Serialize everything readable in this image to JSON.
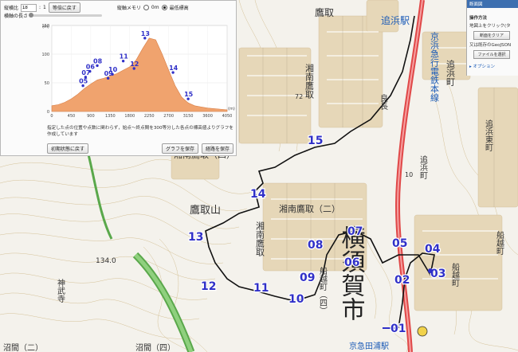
{
  "panel": {
    "ratio_label": "縦横比",
    "ratio_value": "18",
    "ratio_unit": "1",
    "equal_button": "等倍に戻す",
    "axis_label": "縦軸メモリ",
    "radio_zero": "0m",
    "radio_min": "最低標高",
    "length_label": "横軸の長さ",
    "note": "指定した点の位置や点数に関わらず，始点～終点間を300等分した各点の標高値よりグラフを作成しています",
    "reset_button": "初期状態に戻す",
    "save_graph_button": "グラフを保存",
    "save_route_button": "経路を保存"
  },
  "right_panel": {
    "header": "断面図",
    "title": "操作方法",
    "line1": "地図上をクリック(タ",
    "clear_button": "断面をクリア",
    "line2": "又は既存のGeoJSON",
    "file_button": "ファイルを選択",
    "options": "▸ オプション"
  },
  "map_labels": {
    "takatori_top": "鷹取",
    "oppama_station": "追浜駅",
    "keikyu_line": "京浜急行電鉄本線",
    "oppama_cho": "追浜町",
    "oppama_higashi": "追浜東町",
    "shonan_takatori": "湘南鷹取",
    "shonan_takatori_4": "湘南鷹取（四）",
    "takatoriyama": "鷹取山",
    "shonan_takatori_2": "湘南鷹取（二）",
    "shonan_takatori_v": "湘南鷹取",
    "yokosuka": "横須賀市",
    "funakoshi": "船越町",
    "funakoshi_left": "船越町（四）",
    "funakoshi_right": "船越町",
    "buko": "神武寺",
    "numama": "沼間（二）",
    "numama2": "沼間（四）",
    "keikyu_taura": "京急田浦駅",
    "elev_134": "134.0",
    "num_72": "72",
    "num_10": "10",
    "yoshinaga": "良長"
  },
  "chart_data": {
    "type": "area",
    "title": "",
    "xlabel": "(m)",
    "ylabel": "(m)",
    "xlim": [
      0,
      4050
    ],
    "ylim": [
      0,
      150
    ],
    "x_ticks": [
      "0",
      "450",
      "900",
      "1350",
      "1800",
      "2250",
      "2700",
      "3150",
      "3600",
      "4050"
    ],
    "y_ticks": [
      "0",
      "50",
      "100",
      "150"
    ],
    "profile_x": [
      0,
      150,
      300,
      450,
      600,
      750,
      900,
      1050,
      1200,
      1350,
      1500,
      1650,
      1800,
      1950,
      2100,
      2250,
      2400,
      2550,
      2700,
      2850,
      3000,
      3150,
      3300,
      3450,
      3600,
      3750,
      3900,
      4050
    ],
    "profile_y": [
      10,
      12,
      16,
      22,
      30,
      40,
      48,
      55,
      58,
      62,
      66,
      72,
      78,
      90,
      110,
      128,
      125,
      100,
      72,
      45,
      25,
      15,
      10,
      8,
      6,
      5,
      4,
      3
    ],
    "points": [
      {
        "label": "05",
        "x": 720,
        "y": 45
      },
      {
        "label": "07",
        "x": 780,
        "y": 60
      },
      {
        "label": "06",
        "x": 880,
        "y": 70
      },
      {
        "label": "08",
        "x": 1050,
        "y": 80
      },
      {
        "label": "09",
        "x": 1300,
        "y": 58
      },
      {
        "label": "10",
        "x": 1400,
        "y": 65
      },
      {
        "label": "11",
        "x": 1650,
        "y": 88
      },
      {
        "label": "12",
        "x": 1900,
        "y": 75
      },
      {
        "label": "13",
        "x": 2150,
        "y": 128
      },
      {
        "label": "14",
        "x": 2800,
        "y": 68
      },
      {
        "label": "15",
        "x": 3150,
        "y": 22
      }
    ]
  },
  "route_points": [
    {
      "label": "01"
    },
    {
      "label": "02"
    },
    {
      "label": "03"
    },
    {
      "label": "04"
    },
    {
      "label": "05"
    },
    {
      "label": "06"
    },
    {
      "label": "07"
    },
    {
      "label": "08"
    },
    {
      "label": "09"
    },
    {
      "label": "10"
    },
    {
      "label": "11"
    },
    {
      "label": "12"
    },
    {
      "label": "13"
    },
    {
      "label": "14"
    },
    {
      "label": "15"
    }
  ],
  "colors": {
    "route_label": "#3030c8",
    "profile_fill": "#f0a36e",
    "rail": "#e04848",
    "expressway": "#5aa84b"
  }
}
